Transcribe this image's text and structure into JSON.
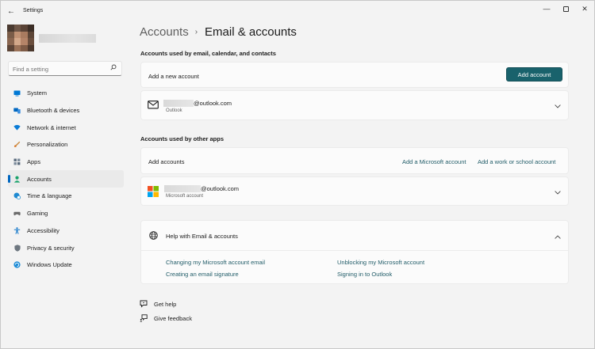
{
  "window": {
    "title": "Settings",
    "back_icon": "arrow-left-icon",
    "controls": [
      "minimize-icon",
      "maximize-icon",
      "close-icon"
    ]
  },
  "search": {
    "placeholder": "Find a setting",
    "icon": "search-icon"
  },
  "nav": {
    "items": [
      {
        "label": "System",
        "icon": "system-icon",
        "color": "#0078d4"
      },
      {
        "label": "Bluetooth & devices",
        "icon": "bluetooth-icon",
        "color": "#0067c0"
      },
      {
        "label": "Network & internet",
        "icon": "wifi-icon",
        "color": "#0a7bd6"
      },
      {
        "label": "Personalization",
        "icon": "brush-icon",
        "color": "#d77a2a"
      },
      {
        "label": "Apps",
        "icon": "apps-icon",
        "color": "#5a6b7d"
      },
      {
        "label": "Accounts",
        "icon": "person-icon",
        "color": "#1aa36b"
      },
      {
        "label": "Time & language",
        "icon": "globe-clock-icon",
        "color": "#1f8ad1"
      },
      {
        "label": "Gaming",
        "icon": "controller-icon",
        "color": "#6b6b6b"
      },
      {
        "label": "Accessibility",
        "icon": "accessibility-icon",
        "color": "#1277c9"
      },
      {
        "label": "Privacy & security",
        "icon": "shield-icon",
        "color": "#6e7780"
      },
      {
        "label": "Windows Update",
        "icon": "update-icon",
        "color": "#1c8bd6"
      }
    ],
    "active_index": 5,
    "accent": "#0067c0"
  },
  "breadcrumb": {
    "parent": "Accounts",
    "separator": "›",
    "current": "Email & accounts"
  },
  "email_section": {
    "title": "Accounts used by email, calendar, and contacts",
    "add_label": "Add a new account",
    "add_button": "Add account",
    "account_email": "@outlook.com",
    "account_type": "Outlook",
    "account_icon": "mail-icon"
  },
  "apps_section": {
    "title": "Accounts used by other apps",
    "add_label": "Add accounts",
    "add_ms_link": "Add a Microsoft account",
    "add_work_link": "Add a work or school account",
    "account_email": "@outlook.com",
    "account_type": "Microsoft account",
    "account_icon": "microsoft-logo-icon"
  },
  "help": {
    "title": "Help with Email & accounts",
    "icon": "globe-icon",
    "links": [
      "Changing my Microsoft account email",
      "Unblocking my Microsoft account",
      "Creating an email signature",
      "Signing in to Outlook"
    ]
  },
  "footer": {
    "get_help": "Get help",
    "give_feedback": "Give feedback"
  },
  "colors": {
    "button_bg": "#19626c",
    "link": "#225d69",
    "window_bg": "#f3f3f3",
    "card_bg": "#fbfbfb"
  }
}
